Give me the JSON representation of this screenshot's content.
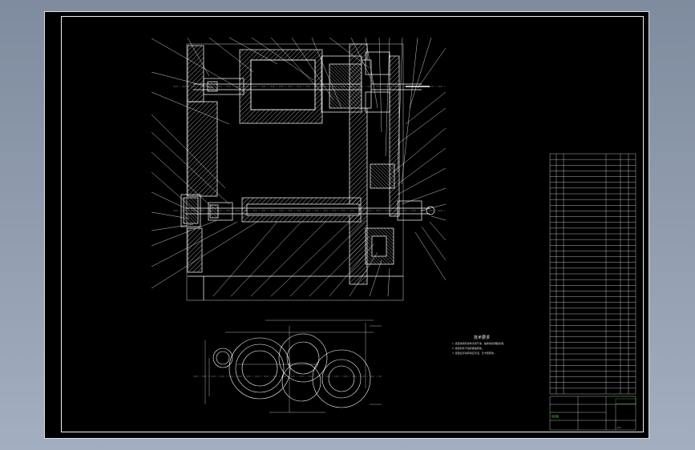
{
  "drawing": {
    "title": "装配图",
    "scale": "1:1",
    "notes": {
      "title": "技术要求",
      "lines": [
        "1. 装配前所有零件清洗干净，轴承用润滑脂润滑。",
        "2. 各密封处不得有漏油现象。",
        "3. 装配后手动转动应灵活，无卡阻现象。"
      ]
    },
    "part_rows": 42,
    "colors": {
      "background": "#000000",
      "lines": "#ffffff",
      "hatch": "#ffffff",
      "highlight": "#4cd14c",
      "viewport": "#8d99ab"
    }
  }
}
